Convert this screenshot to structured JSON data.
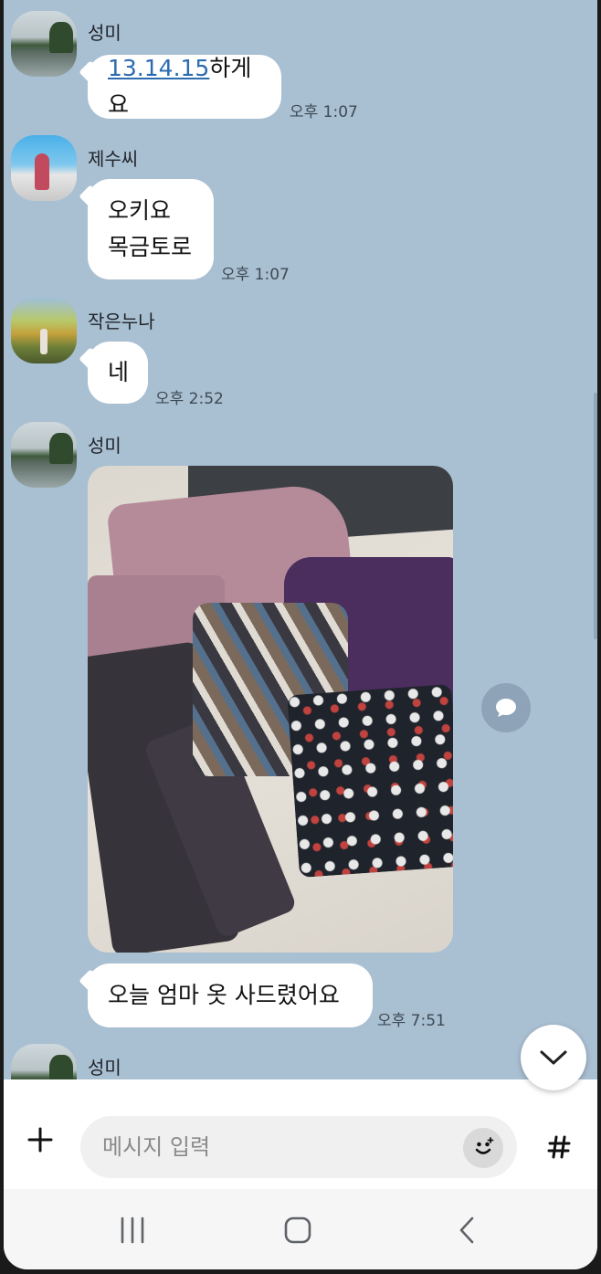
{
  "messages": [
    {
      "sender": "성미",
      "text": "",
      "link_text": "13.14.15",
      "suffix_text": "하게요",
      "time": "오후 1:07"
    },
    {
      "sender": "제수씨",
      "lines": [
        "오키요",
        "목금토로"
      ],
      "time": "오후 1:07"
    },
    {
      "sender": "작은누나",
      "text": "네",
      "time": "오후 2:52"
    },
    {
      "sender": "성미",
      "caption": "오늘 엄마 옷 사드렸어요",
      "time": "오후 7:51"
    },
    {
      "sender": "성미"
    }
  ],
  "input": {
    "placeholder": "메시지 입력",
    "value": ""
  },
  "icons": {
    "plus": "plus-icon",
    "emoji": "emoji-icon",
    "hash": "hashtag-icon",
    "share": "share-icon",
    "scroll_down": "chevron-down-icon",
    "nav_recents": "recents-icon",
    "nav_home": "home-icon",
    "nav_back": "back-icon"
  },
  "colors": {
    "chat_background": "#a9bfd2",
    "bubble": "#ffffff",
    "link": "#2b6cb0"
  }
}
